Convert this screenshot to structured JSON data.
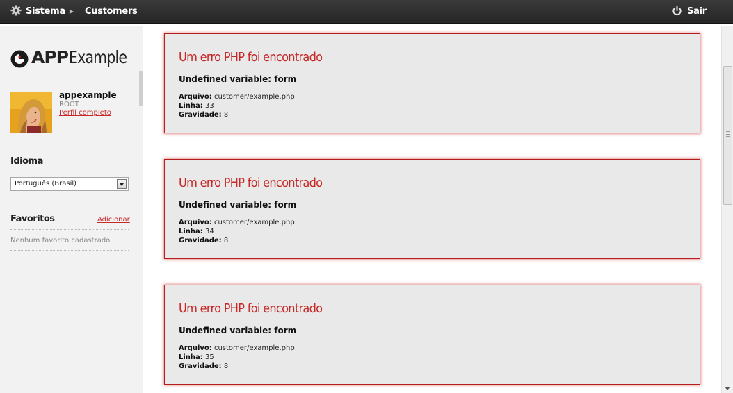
{
  "topbar": {
    "system_label": "Sistema",
    "system_icon": "gear-icon",
    "customers_label": "Customers",
    "logout_label": "Sair",
    "logout_icon": "power-icon"
  },
  "sidebar": {
    "logo": {
      "app": "APP",
      "example": "Example"
    },
    "user": {
      "name": "appexample",
      "role": "ROOT",
      "profile_link": "Perfil completo"
    },
    "language": {
      "title": "Idioma",
      "selected": "Português (Brasil)"
    },
    "favorites": {
      "title": "Favoritos",
      "add_label": "Adicionar",
      "empty_text": "Nenhum favorito cadastrado."
    }
  },
  "errors": [
    {
      "title": "Um erro PHP foi encontrado",
      "message": "Undefined variable: form",
      "file_label": "Arquivo:",
      "file": "customer/example.php",
      "line_label": "Linha:",
      "line": "33",
      "severity_label": "Gravidade:",
      "severity": "8"
    },
    {
      "title": "Um erro PHP foi encontrado",
      "message": "Undefined variable: form",
      "file_label": "Arquivo:",
      "file": "customer/example.php",
      "line_label": "Linha:",
      "line": "34",
      "severity_label": "Gravidade:",
      "severity": "8"
    },
    {
      "title": "Um erro PHP foi encontrado",
      "message": "Undefined variable: form",
      "file_label": "Arquivo:",
      "file": "customer/example.php",
      "line_label": "Linha:",
      "line": "35",
      "severity_label": "Gravidade:",
      "severity": "8"
    }
  ],
  "colors": {
    "accent": "#c62828",
    "topbar": "#2b2b2b",
    "sidebar_bg": "#f2f2f2",
    "error_bg": "#e9e9e9"
  }
}
